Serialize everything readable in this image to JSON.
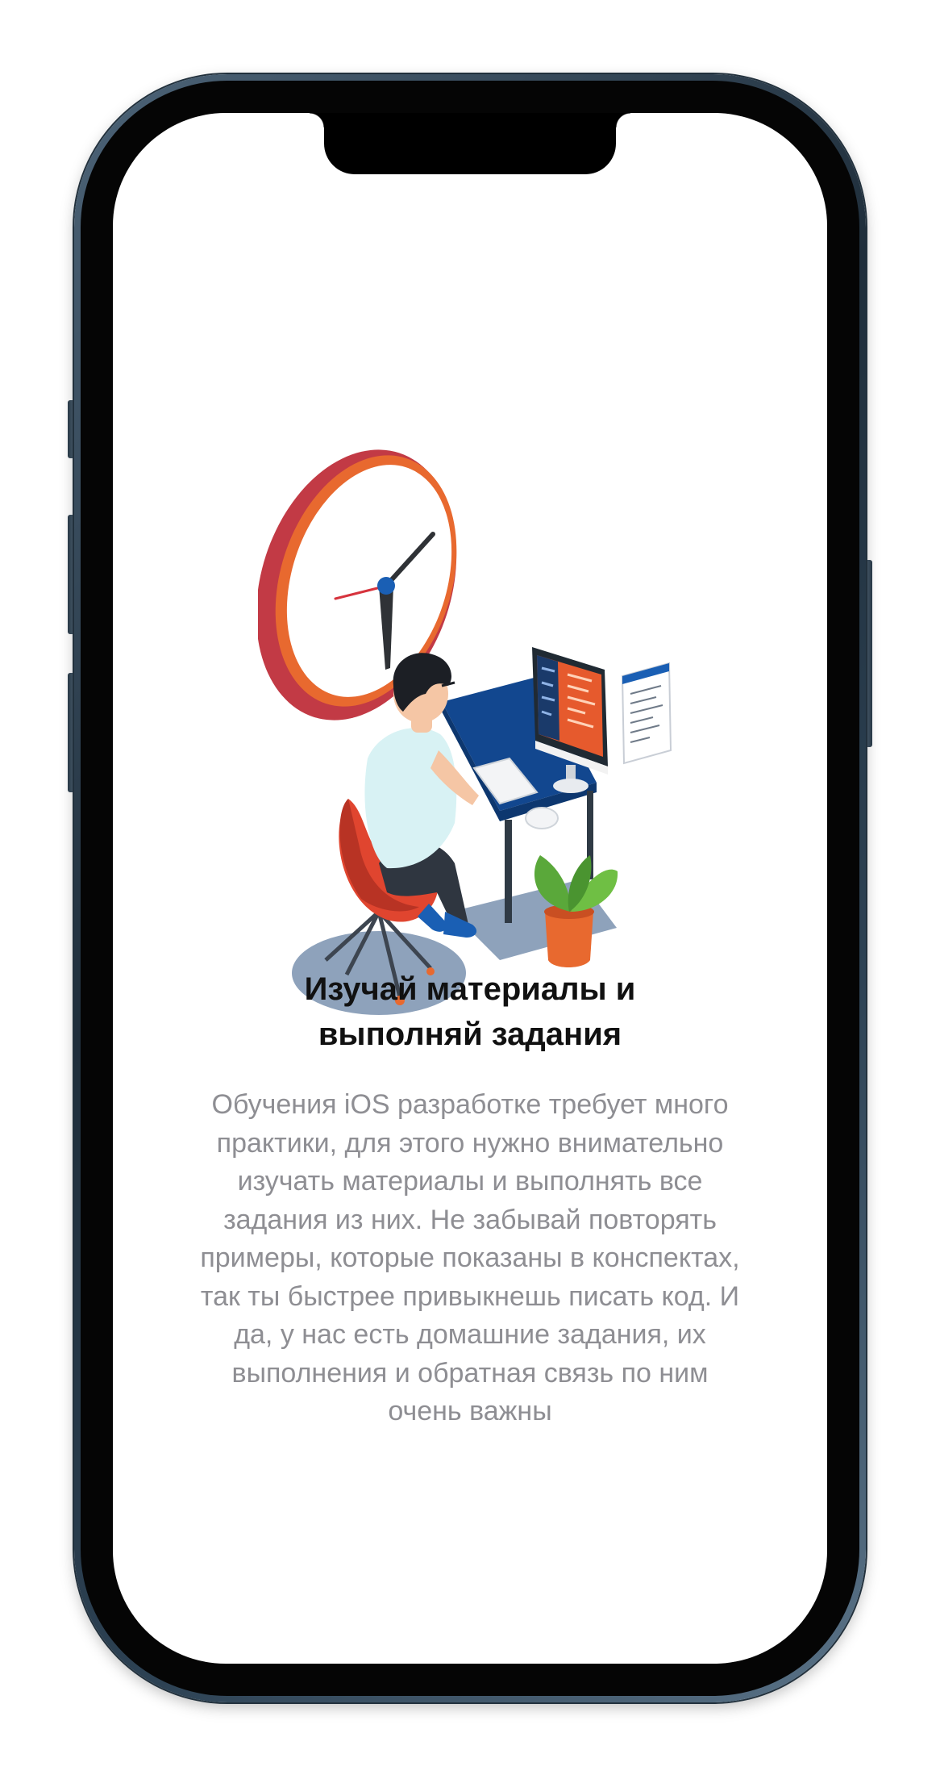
{
  "onboarding": {
    "title_line1": "Изучай материалы и",
    "title_line2": "выполняй задания",
    "description_lines": [
      "Обучения iOS разработке требует много",
      "практики, для этого нужно внимательно",
      "изучать материалы и выполнять все",
      "задания из них. Не забывай повторять",
      "примеры, которые показаны в конспектах,",
      "так ты быстрее привыкнешь писать код. И",
      "да, у нас есть домашние задания, их",
      "выполнения и обратная связь по ним",
      "очень важны"
    ],
    "illustration": "developer-at-desk-illustration"
  },
  "colors": {
    "title": "#111111",
    "body": "#8e8e93",
    "screen_background": "#ffffff",
    "clock_red": "#c8323b",
    "clock_orange": "#e8692f",
    "desk_blue": "#12478f",
    "plant_green": "#5aa83a"
  }
}
